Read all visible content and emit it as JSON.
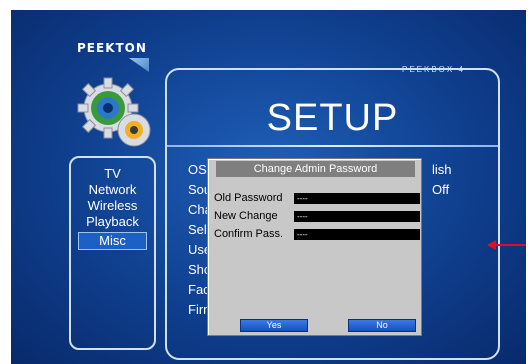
{
  "brand": {
    "name": "PEEKTON",
    "model": "PEEKBOX 4"
  },
  "setup": {
    "title": "SETUP"
  },
  "sidebar": {
    "items": [
      {
        "label": "TV",
        "active": false
      },
      {
        "label": "Network",
        "active": false
      },
      {
        "label": "Wireless",
        "active": false
      },
      {
        "label": "Playback",
        "active": false
      },
      {
        "label": "Misc",
        "active": true
      }
    ]
  },
  "menu": {
    "items": [
      "OSD",
      "Sound",
      "Change",
      "Select",
      "User",
      "Show",
      "Factory",
      "Firmware"
    ],
    "values": [
      "lish",
      "Off"
    ]
  },
  "dialog": {
    "title": "Change Admin Password",
    "fields": [
      {
        "label": "Old Password",
        "value": "----"
      },
      {
        "label": "New Change",
        "value": "----"
      },
      {
        "label": "Confirm Pass.",
        "value": "----"
      }
    ],
    "yes_label": "Yes",
    "no_label": "No"
  },
  "colors": {
    "screen_bg": "#0f3f8e",
    "active_item": "#1d5fc4",
    "dialog_bg": "#c8c8c8",
    "dialog_title_bg": "#7f7f7f",
    "arrow": "#e0101a"
  }
}
